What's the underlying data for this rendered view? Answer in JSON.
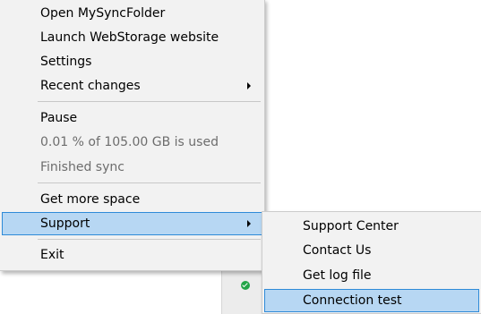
{
  "main_menu": {
    "open_folder_label": "Open MySyncFolder",
    "launch_website_label": "Launch WebStorage website",
    "settings_label": "Settings",
    "recent_changes_label": "Recent changes",
    "pause_label": "Pause",
    "usage_text": "0.01 % of 105.00 GB is used",
    "sync_status_text": "Finished sync",
    "get_more_space_label": "Get more space",
    "support_label": "Support",
    "exit_label": "Exit"
  },
  "support_submenu": {
    "support_center_label": "Support Center",
    "contact_us_label": "Contact Us",
    "get_log_file_label": "Get log file",
    "connection_test_label": "Connection test"
  },
  "tray": {
    "icon": "sync-ok-check-icon",
    "icon_color": "#22a447"
  },
  "colors": {
    "menu_background": "#f2f2f2",
    "highlight_background": "#b7d7f3",
    "highlight_border": "#2e8ad8",
    "disabled_text": "#6d6d6d"
  }
}
